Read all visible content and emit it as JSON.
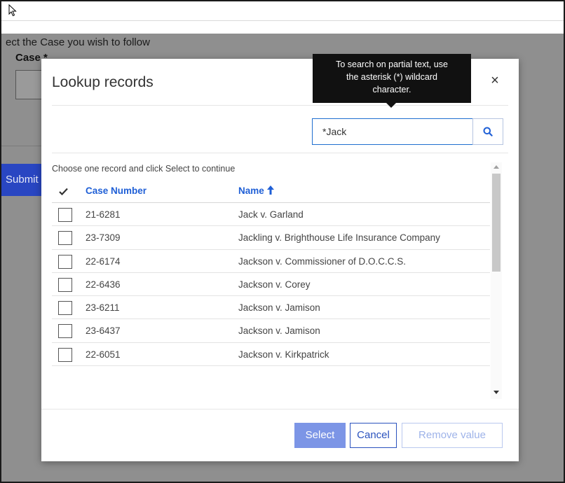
{
  "background": {
    "prompt": "ect the Case you wish to follow",
    "case_label": "Case *",
    "submit_label": "Submit"
  },
  "modal": {
    "title": "Lookup records",
    "close_glyph": "×",
    "tooltip_lines": [
      "To search on partial text, use",
      "the asterisk (*) wildcard",
      "character."
    ],
    "search": {
      "value": "*Jack",
      "placeholder": ""
    },
    "instruction": "Choose one record and click Select to continue",
    "columns": {
      "case_number": "Case Number",
      "name": "Name"
    },
    "rows": [
      {
        "case_number": "21-6281",
        "name": "Jack v. Garland"
      },
      {
        "case_number": "23-7309",
        "name": "Jackling v. Brighthouse Life Insurance Company"
      },
      {
        "case_number": "22-6174",
        "name": "Jackson v. Commissioner of D.O.C.C.S."
      },
      {
        "case_number": "22-6436",
        "name": "Jackson v. Corey"
      },
      {
        "case_number": "23-6211",
        "name": "Jackson v. Jamison"
      },
      {
        "case_number": "23-6437",
        "name": "Jackson v. Jamison"
      },
      {
        "case_number": "22-6051",
        "name": "Jackson v. Kirkpatrick"
      }
    ],
    "buttons": {
      "select": "Select",
      "cancel": "Cancel",
      "remove": "Remove value"
    }
  },
  "colors": {
    "accent": "#1f5fd6",
    "select_button": "#7c95e6",
    "tooltip_bg": "#111111",
    "overlay": "#8f8f8f"
  },
  "icons": [
    "cursor-icon",
    "close-icon",
    "search-icon",
    "checkmark-icon",
    "sort-up-icon",
    "scroll-up-icon",
    "scroll-down-icon"
  ]
}
